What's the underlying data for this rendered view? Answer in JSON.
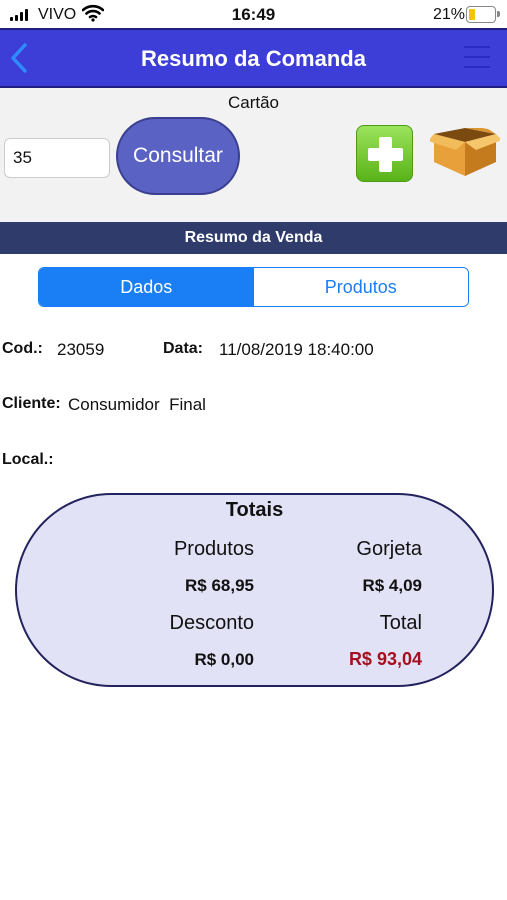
{
  "status_bar": {
    "carrier": "VIVO",
    "time": "16:49",
    "battery": "21%",
    "battery_level": 0.21
  },
  "nav": {
    "title": "Resumo da Comanda",
    "back_icon": "chevron-left-icon",
    "menu_icon": "hamburger-menu-icon"
  },
  "card": {
    "label": "Cartão",
    "input_value": "35",
    "consult_button": "Consultar",
    "add_icon": "plus-icon",
    "box_icon": "box-icon"
  },
  "section": {
    "title": "Resumo da Venda"
  },
  "tabs": {
    "dados": "Dados",
    "produtos": "Produtos",
    "selected": "Dados"
  },
  "details": {
    "cod_label": "Cod.:",
    "cod_value": "23059",
    "data_label": "Data:",
    "data_value": "11/08/2019 18:40:00",
    "cliente_label": "Cliente:",
    "cliente_value": "Consumidor  Final",
    "local_label": "Local.:",
    "local_value": ""
  },
  "totals": {
    "title": "Totais",
    "produtos_label": "Produtos",
    "produtos_value": "R$ 68,95",
    "gorjeta_label": "Gorjeta",
    "gorjeta_value": "R$ 4,09",
    "desconto_label": "Desconto",
    "desconto_value": "R$ 0,00",
    "total_label": "Total",
    "total_value": "R$ 93,04"
  },
  "colors": {
    "nav_bg": "#3d3dd8",
    "section_bg": "#2f3c6b",
    "tab_accent": "#1a7ef5",
    "total_value": "#a50f1e",
    "totals_bg": "#e2e2f6"
  }
}
